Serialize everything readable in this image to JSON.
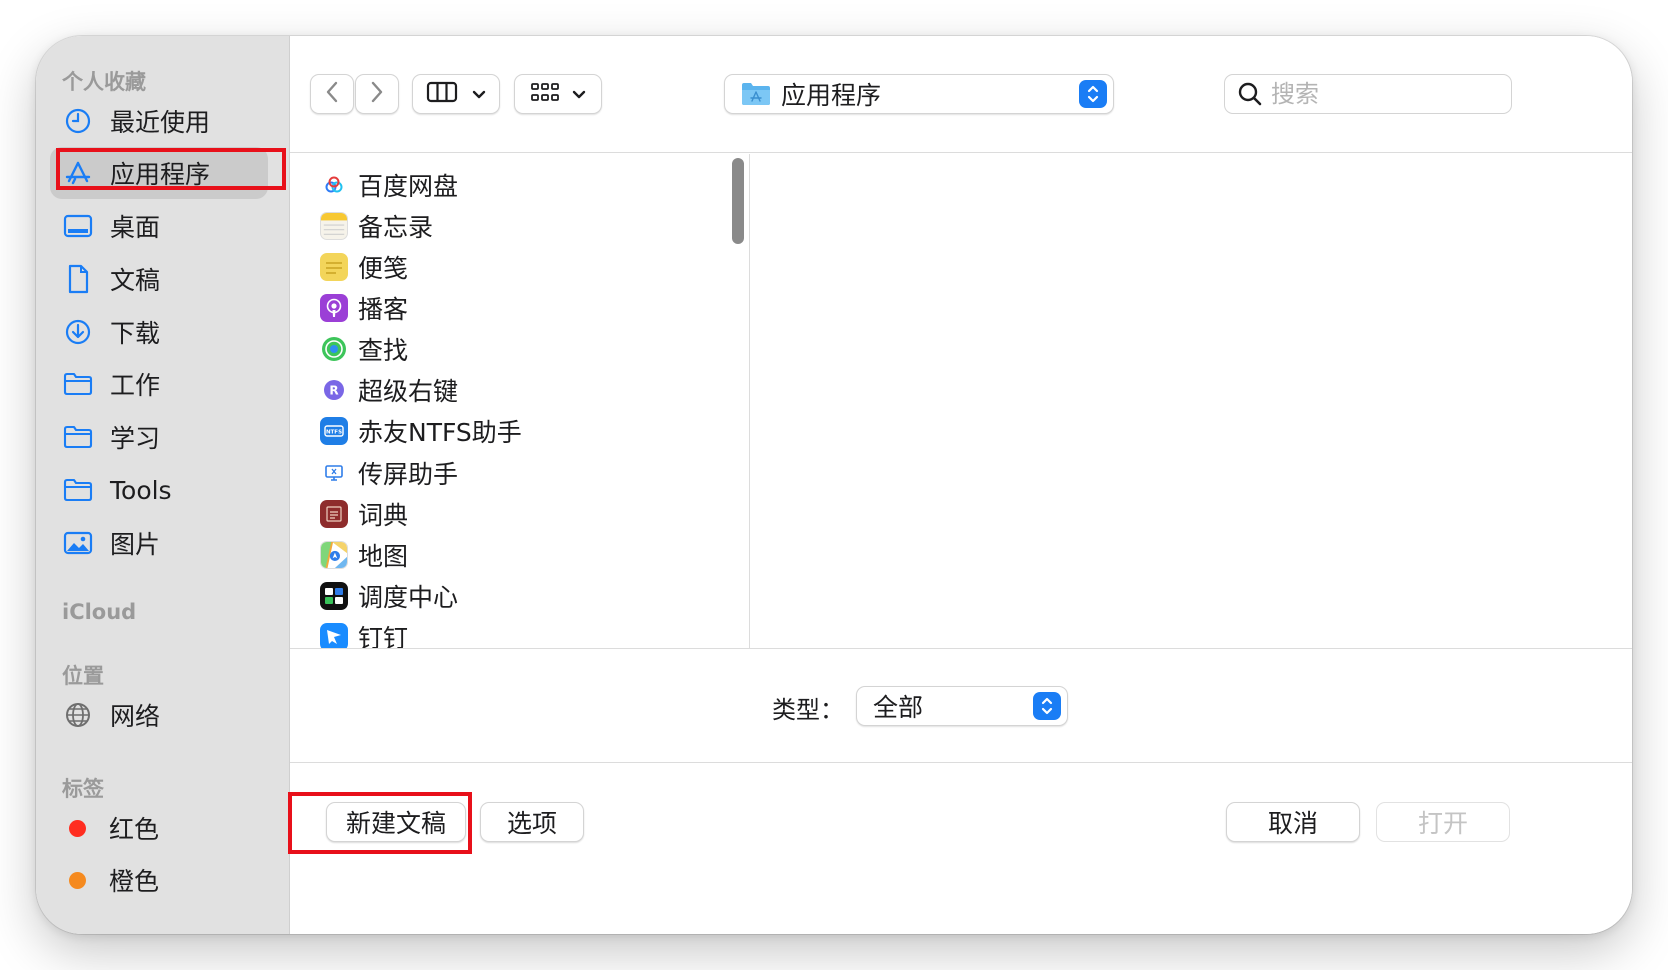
{
  "sidebar": {
    "favorites_header": "个人收藏",
    "favorites": [
      {
        "label": "最近使用",
        "icon": "clock-icon"
      },
      {
        "label": "应用程序",
        "icon": "applications-icon",
        "selected": true
      },
      {
        "label": "桌面",
        "icon": "desktop-icon"
      },
      {
        "label": "文稿",
        "icon": "document-icon"
      },
      {
        "label": "下载",
        "icon": "download-icon"
      },
      {
        "label": "工作",
        "icon": "folder-icon"
      },
      {
        "label": "学习",
        "icon": "folder-icon"
      },
      {
        "label": "Tools",
        "icon": "folder-icon"
      },
      {
        "label": "图片",
        "icon": "photo-icon"
      }
    ],
    "icloud_header": "iCloud",
    "locations_header": "位置",
    "locations": [
      {
        "label": "网络",
        "icon": "globe-icon"
      }
    ],
    "tags_header": "标签",
    "tags": [
      {
        "label": "红色",
        "color": "#ff2d20"
      },
      {
        "label": "橙色",
        "color": "#f58a1f"
      }
    ]
  },
  "toolbar": {
    "path_label": "应用程序",
    "search_placeholder": "搜索"
  },
  "files": [
    {
      "label": "百度网盘",
      "icon": "baidu-netdisk-icon"
    },
    {
      "label": "备忘录",
      "icon": "notes-icon"
    },
    {
      "label": "便笺",
      "icon": "stickies-icon"
    },
    {
      "label": "播客",
      "icon": "podcasts-icon"
    },
    {
      "label": "查找",
      "icon": "find-my-icon"
    },
    {
      "label": "超级右键",
      "icon": "super-right-click-icon"
    },
    {
      "label": "赤友NTFS助手",
      "icon": "ntfs-icon"
    },
    {
      "label": "传屏助手",
      "icon": "screen-cast-icon"
    },
    {
      "label": "词典",
      "icon": "dictionary-icon"
    },
    {
      "label": "地图",
      "icon": "maps-icon"
    },
    {
      "label": "调度中心",
      "icon": "mission-control-icon"
    },
    {
      "label": "钉钉",
      "icon": "dingtalk-icon"
    }
  ],
  "filter": {
    "type_label": "类型：",
    "type_value": "全部"
  },
  "buttons": {
    "new_document": "新建文稿",
    "options": "选项",
    "cancel": "取消",
    "open": "打开"
  },
  "colors": {
    "accent": "#1a7df5",
    "highlight_box": "#e8101a"
  }
}
